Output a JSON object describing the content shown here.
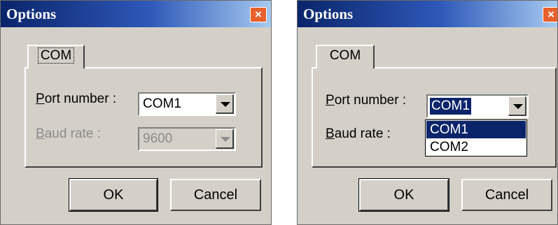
{
  "left_dialog": {
    "title": "Options",
    "close_glyph": "×",
    "tab_label": "COM",
    "port_label_mnemonic": "P",
    "port_label_rest": "ort number :",
    "port_value": "COM1",
    "baud_label_mnemonic": "B",
    "baud_label_rest": "aud rate :",
    "baud_value": "9600",
    "baud_disabled": true,
    "ok_label": "OK",
    "cancel_label": "Cancel"
  },
  "right_dialog": {
    "title": "Options",
    "close_glyph": "×",
    "tab_label": "COM",
    "port_label_mnemonic": "P",
    "port_label_rest": "ort number :",
    "port_value": "COM1",
    "port_dropdown_open": true,
    "port_options": [
      "COM1",
      "COM2"
    ],
    "port_highlighted_option": "COM1",
    "baud_label_mnemonic": "B",
    "baud_label_rest": "aud rate :",
    "ok_label": "OK",
    "cancel_label": "Cancel"
  },
  "colors": {
    "title_bar_start": "#0a246a",
    "title_bar_end": "#a6caf0",
    "dialog_face": "#d4d0c8",
    "close_button": "#e8602c",
    "selection": "#0a246a",
    "disabled_text": "#8c8c8c"
  },
  "icons": {
    "close": "close-icon",
    "dropdown": "chevron-down-icon"
  }
}
